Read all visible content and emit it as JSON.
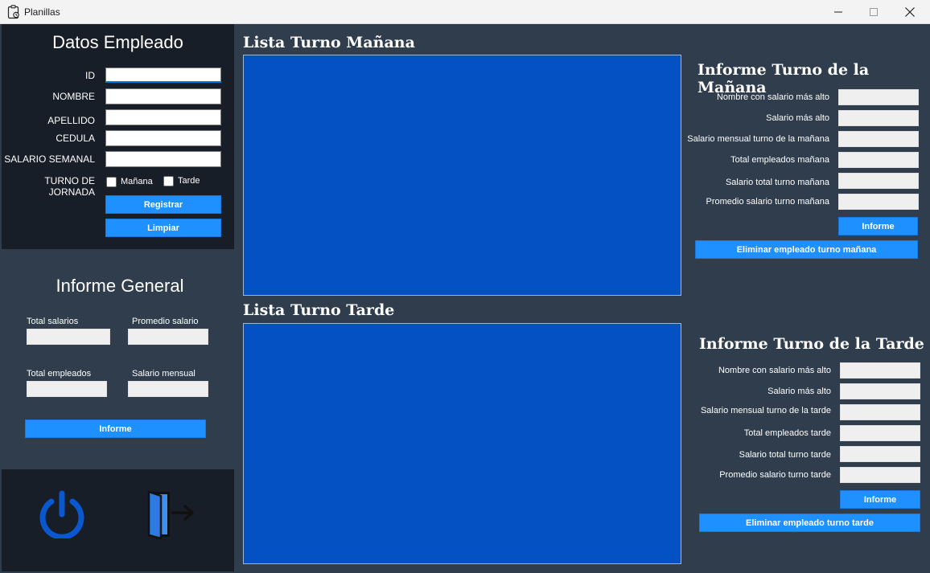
{
  "window": {
    "title": "Planillas",
    "icon": "clipboard-icon"
  },
  "datos": {
    "title": "Datos Empleado",
    "id_label": "ID",
    "nombre_label": "NOMBRE",
    "apellido_label": "APELLIDO",
    "cedula_label": "CEDULA",
    "salario_label": "SALARIO SEMANAL",
    "turno_label": "TURNO DE JORNADA",
    "manana_label": "Mañana",
    "tarde_label": "Tarde",
    "id_value": "",
    "nombre_value": "",
    "apellido_value": "",
    "cedula_value": "",
    "salario_value": "",
    "registrar_label": "Registrar",
    "limpiar_label": "Limpiar"
  },
  "general": {
    "title": "Informe General",
    "total_salarios_label": "Total salarios",
    "promedio_salario_label": "Promedio salario",
    "total_empleados_label": "Total empleados",
    "salario_mensual_label": "Salario mensual",
    "informe_label": "Informe"
  },
  "bottom": {
    "power_icon": "power-icon",
    "exit_icon": "exit-door-icon"
  },
  "lista_manana": {
    "title": "Lista Turno Mañana"
  },
  "lista_tarde": {
    "title": "Lista Turno Tarde"
  },
  "informe_manana": {
    "title": "Informe Turno de la Mañana",
    "labels": [
      "Nombre con salario más alto",
      "Salario más alto",
      "Salario mensual turno de la mañana",
      "Total empleados mañana",
      "Salario total turno mañana",
      "Promedio salario turno mañana"
    ],
    "informe_label": "Informe",
    "eliminar_label": "Eliminar empleado turno mañana"
  },
  "informe_tarde": {
    "title": "Informe Turno de la Tarde",
    "labels": [
      "Nombre con salario más alto",
      "Salario más alto",
      "Salario mensual turno de la tarde",
      "Total empleados tarde",
      "Salario total turno tarde",
      "Promedio salario turno tarde"
    ],
    "informe_label": "Informe",
    "eliminar_label": "Eliminar empleado turno tarde"
  },
  "colors": {
    "accent": "#1e90ff",
    "list_background": "#0451c4",
    "dark_panel": "#181e27",
    "main_background": "#2f3d4c"
  }
}
